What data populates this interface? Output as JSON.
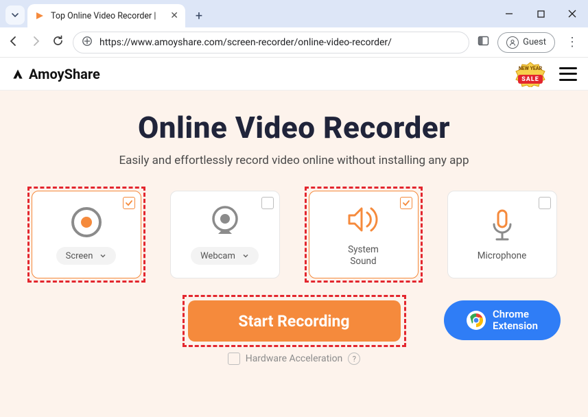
{
  "browser": {
    "tab_title": "Top Online Video Recorder |",
    "url": "https://www.amoyshare.com/screen-recorder/online-video-recorder/",
    "guest_label": "Guest"
  },
  "site": {
    "brand": "AmoyShare",
    "sale_top": "NEW YEAR",
    "sale_mid": "SALE"
  },
  "hero": {
    "title": "Online Video Recorder",
    "subtitle": "Easily and effortlessly record video online without installing any app"
  },
  "cards": [
    {
      "key": "screen",
      "label": "Screen",
      "has_dropdown": true,
      "selected": true,
      "highlighted": true
    },
    {
      "key": "webcam",
      "label": "Webcam",
      "has_dropdown": true,
      "selected": false,
      "highlighted": false
    },
    {
      "key": "system_sound",
      "label": "System\nSound",
      "has_dropdown": false,
      "selected": true,
      "highlighted": true
    },
    {
      "key": "microphone",
      "label": "Microphone",
      "has_dropdown": false,
      "selected": false,
      "highlighted": false
    }
  ],
  "actions": {
    "start": "Start Recording",
    "extension_line1": "Chrome",
    "extension_line2": "Extension",
    "hw_accel": "Hardware Acceleration"
  }
}
